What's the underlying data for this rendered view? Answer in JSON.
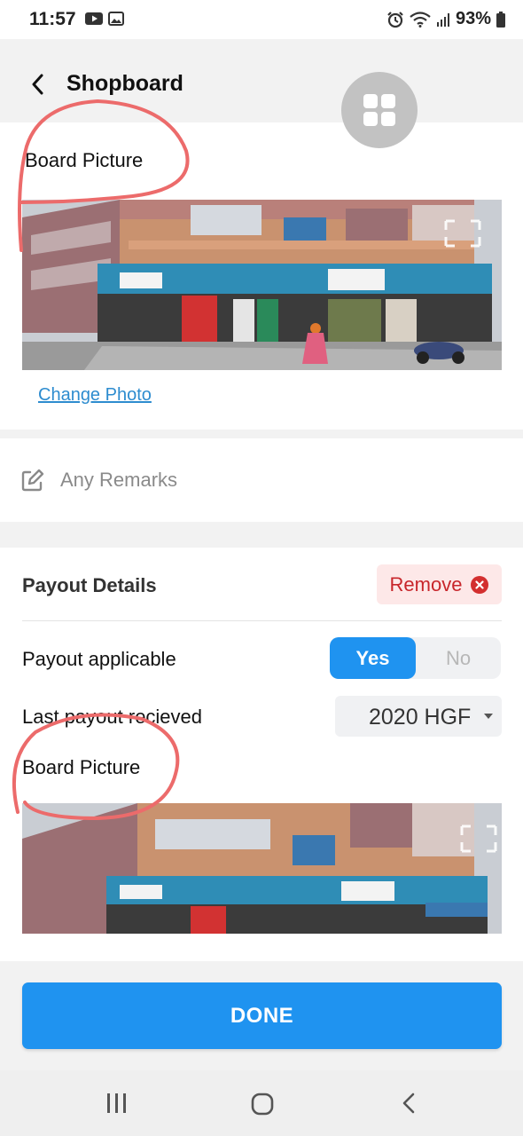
{
  "status_bar": {
    "time": "11:57",
    "battery": "93%",
    "icons": [
      "youtube-icon",
      "gallery-icon",
      "alarm-icon",
      "wifi-icon",
      "signal-icon",
      "battery-icon"
    ]
  },
  "header": {
    "title": "Shopboard",
    "back_icon": "back-arrow-icon",
    "fab_icon": "apps-grid-icon"
  },
  "board_section": {
    "label": "Board Picture",
    "change_photo": "Change Photo",
    "expand_icon": "expand-icon"
  },
  "remarks": {
    "placeholder": "Any Remarks",
    "icon": "edit-icon"
  },
  "payout": {
    "title": "Payout Details",
    "remove_label": "Remove",
    "remove_icon": "close-circle-icon",
    "applicable_label": "Payout applicable",
    "yes_label": "Yes",
    "no_label": "No",
    "selected": "Yes",
    "last_payout_label": "Last payout recieved",
    "last_payout_value": "2020 HGF",
    "second_board_label": "Board Picture"
  },
  "footer": {
    "done_label": "DONE"
  },
  "nav": {
    "icons": [
      "recent-apps-icon",
      "home-icon",
      "back-icon"
    ]
  },
  "colors": {
    "accent": "#1f93f0",
    "remove_bg": "#fde8e8",
    "remove_text": "#c8262b",
    "link": "#2d8ccf",
    "annotation": "#ec6b6b"
  }
}
